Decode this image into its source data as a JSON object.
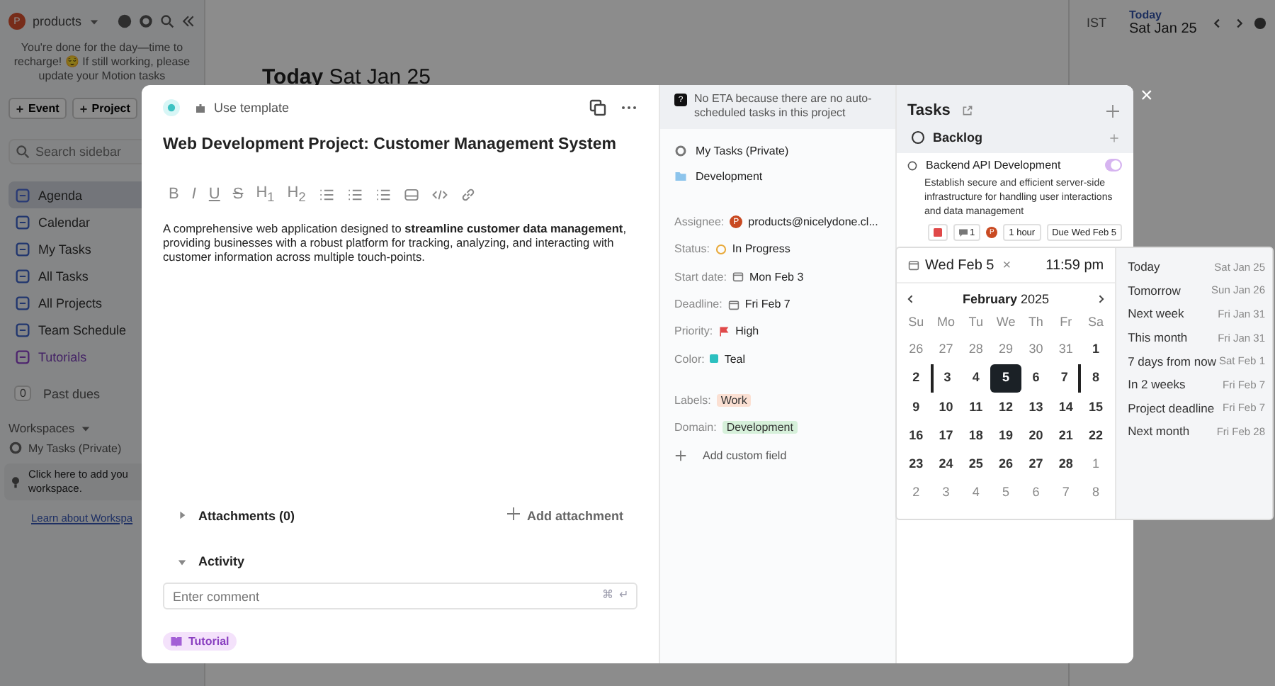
{
  "sidebar": {
    "workspace": "products",
    "workspace_initial": "P",
    "notice": "You're done for the day—time to recharge! 😌 If still working, please update your Motion tasks",
    "buttons": [
      "Event",
      "Project"
    ],
    "search": {
      "placeholder": "Search sidebar"
    },
    "items": [
      {
        "label": "Agenda",
        "kind": "agenda",
        "selected": true
      },
      {
        "label": "Calendar",
        "kind": "calendar",
        "selected": false
      },
      {
        "label": "My Tasks",
        "kind": "my-tasks",
        "selected": false
      },
      {
        "label": "All Tasks",
        "kind": "all-tasks",
        "selected": false
      },
      {
        "label": "All Projects",
        "kind": "projects",
        "selected": false
      },
      {
        "label": "Team Schedule",
        "kind": "team",
        "selected": false
      },
      {
        "label": "Tutorials",
        "kind": "tutorials",
        "selected": false
      }
    ],
    "past_dues": {
      "count": "0",
      "label": "Past dues"
    },
    "workspaces_heading": "Workspaces",
    "workspace_item": "My Tasks (Private)",
    "hint": "Click here to add you workspace.",
    "learn_link": "Learn about Workspa"
  },
  "main": {
    "title": "Today",
    "date": "Sat Jan 25"
  },
  "right_header": {
    "timezone": "IST",
    "today": "Today",
    "date": "Sat Jan 25"
  },
  "modal": {
    "template_button": "Use template",
    "title": "Web Development Project: Customer Management System",
    "toolbar": [
      {
        "kind": "bold",
        "label": "B"
      },
      {
        "kind": "italic",
        "label": "I"
      },
      {
        "kind": "underline",
        "label": "U"
      },
      {
        "kind": "strike",
        "label": "S"
      },
      {
        "kind": "heading",
        "label": "H$_{1}$"
      },
      {
        "kind": "heading",
        "label": "H$_{2}$"
      },
      {
        "kind": "bullets"
      },
      {
        "kind": "numbers"
      },
      {
        "kind": "checklist"
      },
      {
        "kind": "image"
      },
      {
        "kind": "code"
      },
      {
        "kind": "link"
      }
    ],
    "description": "A comprehensive web application designed to **streamline customer data management**, providing businesses with a robust platform for tracking, analyzing, and interacting with customer information across multiple touch-points.",
    "attachments": "Attachments (0)",
    "add_attachment": "Add attachment",
    "activity": "Activity",
    "comment": {
      "placeholder": "Enter comment",
      "keys": [
        "⌘",
        "↵"
      ]
    },
    "tutorial": "Tutorial"
  },
  "details": {
    "eta_notice": "No ETA because there are no auto-scheduled tasks in this project",
    "eta_icon": "?",
    "workspace": "My Tasks (Private)",
    "project": "Development",
    "fields": [
      {
        "label": "Assignee:",
        "kind": "avatar",
        "icon_text": "P",
        "value": "products@nicelydone.cl..."
      },
      {
        "label": "Status:",
        "kind": "status",
        "value": "In Progress"
      },
      {
        "label": "Start date:",
        "kind": "date",
        "value": "Mon Feb 3"
      },
      {
        "label": "Deadline:",
        "kind": "date",
        "value": "Fri Feb 7"
      },
      {
        "label": "Priority:",
        "kind": "flag",
        "value": "High"
      },
      {
        "label": "Color:",
        "kind": "swatch",
        "value": "Teal"
      }
    ],
    "tags": [
      {
        "label": "Labels:",
        "value": "Work",
        "color": "#fbe0d3"
      },
      {
        "label": "Domain:",
        "value": "Development",
        "color": "#d6f0da"
      }
    ],
    "add_field": "Add custom field"
  },
  "tasks": {
    "title": "Tasks",
    "group": "Backlog",
    "task": {
      "name": "Backend API Development",
      "description": "Establish secure and efficient server-side infrastructure for handling user interactions and data management",
      "comments": "1",
      "avatar": "P",
      "duration": "1 hour",
      "due": "Due Wed Feb 5"
    }
  },
  "close": "×",
  "date_picker": {
    "date": "Wed Feb 5",
    "clear": "×",
    "time": "11:59 pm",
    "month": "February",
    "year": "2025",
    "weekdays": [
      "Su",
      "Mo",
      "Tu",
      "We",
      "Th",
      "Fr",
      "Sa"
    ],
    "weeks": [
      [
        {
          "label": "26",
          "kind": "outside"
        },
        {
          "label": "27",
          "kind": "outside"
        },
        {
          "label": "28",
          "kind": "outside"
        },
        {
          "label": "29",
          "kind": "outside"
        },
        {
          "label": "30",
          "kind": "outside"
        },
        {
          "label": "31",
          "kind": "outside"
        },
        {
          "label": "1",
          "kind": "day"
        }
      ],
      [
        {
          "label": "2",
          "kind": "day"
        },
        {
          "label": "3",
          "kind": "start"
        },
        {
          "label": "4",
          "kind": "day"
        },
        {
          "label": "5",
          "kind": "selected"
        },
        {
          "label": "6",
          "kind": "day"
        },
        {
          "label": "7",
          "kind": "end"
        },
        {
          "label": "8",
          "kind": "day"
        }
      ],
      [
        {
          "label": "9",
          "kind": "day"
        },
        {
          "label": "10",
          "kind": "day"
        },
        {
          "label": "11",
          "kind": "day"
        },
        {
          "label": "12",
          "kind": "day"
        },
        {
          "label": "13",
          "kind": "day"
        },
        {
          "label": "14",
          "kind": "day"
        },
        {
          "label": "15",
          "kind": "day"
        }
      ],
      [
        {
          "label": "16",
          "kind": "day"
        },
        {
          "label": "17",
          "kind": "day"
        },
        {
          "label": "18",
          "kind": "day"
        },
        {
          "label": "19",
          "kind": "day"
        },
        {
          "label": "20",
          "kind": "day"
        },
        {
          "label": "21",
          "kind": "day"
        },
        {
          "label": "22",
          "kind": "day"
        }
      ],
      [
        {
          "label": "23",
          "kind": "day"
        },
        {
          "label": "24",
          "kind": "day"
        },
        {
          "label": "25",
          "kind": "day"
        },
        {
          "label": "26",
          "kind": "day"
        },
        {
          "label": "27",
          "kind": "day"
        },
        {
          "label": "28",
          "kind": "day"
        },
        {
          "label": "1",
          "kind": "outside"
        }
      ],
      [
        {
          "label": "2",
          "kind": "outside"
        },
        {
          "label": "3",
          "kind": "outside"
        },
        {
          "label": "4",
          "kind": "outside"
        },
        {
          "label": "5",
          "kind": "outside"
        },
        {
          "label": "6",
          "kind": "outside"
        },
        {
          "label": "7",
          "kind": "outside"
        },
        {
          "label": "8",
          "kind": "outside"
        }
      ]
    ],
    "shortcuts": [
      {
        "label": "Today",
        "date": "Sat Jan 25"
      },
      {
        "label": "Tomorrow",
        "date": "Sun Jan 26"
      },
      {
        "label": "Next week",
        "date": "Fri Jan 31"
      },
      {
        "label": "This month",
        "date": "Fri Jan 31"
      },
      {
        "label": "7 days from now",
        "date": "Sat Feb 1"
      },
      {
        "label": "In 2 weeks",
        "date": "Fri Feb 7"
      },
      {
        "label": "Project deadline",
        "date": "Fri Feb 7"
      },
      {
        "label": "Next month",
        "date": "Fri Feb 28"
      }
    ]
  }
}
